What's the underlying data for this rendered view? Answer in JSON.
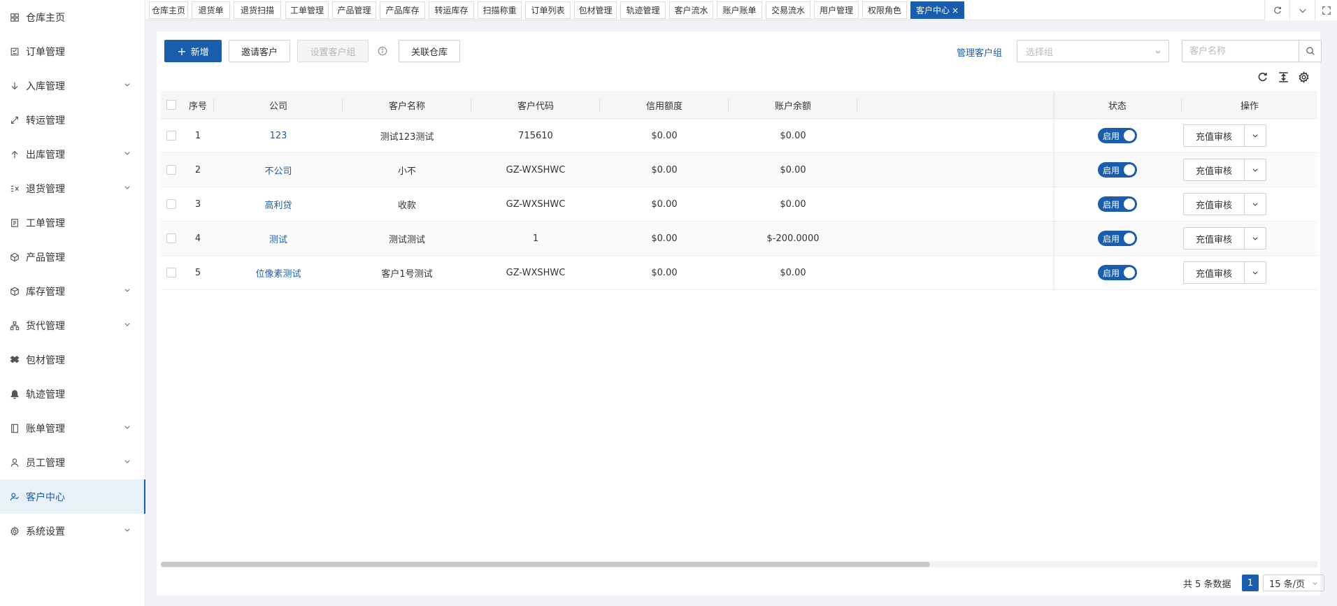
{
  "sidebar": {
    "items": [
      {
        "label": "仓库主页",
        "icon": "grid-icon",
        "has_children": false
      },
      {
        "label": "订单管理",
        "icon": "order-icon",
        "has_children": false
      },
      {
        "label": "入库管理",
        "icon": "arrow-down-icon",
        "has_children": true
      },
      {
        "label": "转运管理",
        "icon": "transfer-icon",
        "has_children": false
      },
      {
        "label": "出库管理",
        "icon": "arrow-up-icon",
        "has_children": true
      },
      {
        "label": "退货管理",
        "icon": "return-icon",
        "has_children": true
      },
      {
        "label": "工单管理",
        "icon": "ticket-icon",
        "has_children": false
      },
      {
        "label": "产品管理",
        "icon": "box-icon",
        "has_children": false
      },
      {
        "label": "库存管理",
        "icon": "cube-icon",
        "has_children": true
      },
      {
        "label": "货代管理",
        "icon": "network-icon",
        "has_children": true
      },
      {
        "label": "包材管理",
        "icon": "dropbox-icon",
        "has_children": false
      },
      {
        "label": "轨迹管理",
        "icon": "bell-icon",
        "has_children": false
      },
      {
        "label": "账单管理",
        "icon": "book-icon",
        "has_children": true
      },
      {
        "label": "员工管理",
        "icon": "user-icon",
        "has_children": true
      },
      {
        "label": "客户中心",
        "icon": "customer-icon",
        "has_children": false,
        "active": true
      },
      {
        "label": "系统设置",
        "icon": "gear-icon",
        "has_children": true
      }
    ]
  },
  "tabs": [
    {
      "label": "仓库主页"
    },
    {
      "label": "退货单"
    },
    {
      "label": "退货扫描"
    },
    {
      "label": "工单管理"
    },
    {
      "label": "产品管理"
    },
    {
      "label": "产品库存"
    },
    {
      "label": "转运库存"
    },
    {
      "label": "扫描称重"
    },
    {
      "label": "订单列表"
    },
    {
      "label": "包材管理"
    },
    {
      "label": "轨迹管理"
    },
    {
      "label": "客户流水"
    },
    {
      "label": "账户账单"
    },
    {
      "label": "交易流水"
    },
    {
      "label": "用户管理"
    },
    {
      "label": "权限角色"
    },
    {
      "label": "客户中心",
      "active": true,
      "close": "×"
    }
  ],
  "toolbar": {
    "add_label": "新增",
    "add_icon": "+",
    "invite_label": "邀请客户",
    "set_group_label": "设置客户组",
    "link_warehouse_label": "关联仓库",
    "manage_group_label": "管理客户组",
    "group_select_placeholder": "选择组",
    "search_placeholder": "客户名称"
  },
  "table": {
    "columns": [
      "序号",
      "公司",
      "客户名称",
      "客户代码",
      "信用额度",
      "账户余额",
      "状态",
      "操作"
    ],
    "rows": [
      {
        "index": "1",
        "company": "123",
        "name": "测试123测试",
        "code": "715610",
        "credit": "$0.00",
        "balance": "$0.00",
        "status": "启用",
        "action": "充值审核"
      },
      {
        "index": "2",
        "company": "不公司",
        "name": "小不",
        "code": "GZ-WXSHWC",
        "credit": "$0.00",
        "balance": "$0.00",
        "status": "启用",
        "action": "充值审核"
      },
      {
        "index": "3",
        "company": "高利贷",
        "name": "收款",
        "code": "GZ-WXSHWC",
        "credit": "$0.00",
        "balance": "$0.00",
        "status": "启用",
        "action": "充值审核"
      },
      {
        "index": "4",
        "company": "测试",
        "name": "测试测试",
        "code": "1",
        "credit": "$0.00",
        "balance": "$-200.0000",
        "status": "启用",
        "action": "充值审核"
      },
      {
        "index": "5",
        "company": "位像素测试",
        "name": "客户1号测试",
        "code": "GZ-WXSHWC",
        "credit": "$0.00",
        "balance": "$0.00",
        "status": "启用",
        "action": "充值审核"
      }
    ]
  },
  "pagination": {
    "total_text": "共 5 条数据",
    "current_page": "1",
    "page_size": "15 条/页"
  },
  "colors": {
    "primary": "#1a5dad",
    "active_bg": "#e8f0fa"
  }
}
